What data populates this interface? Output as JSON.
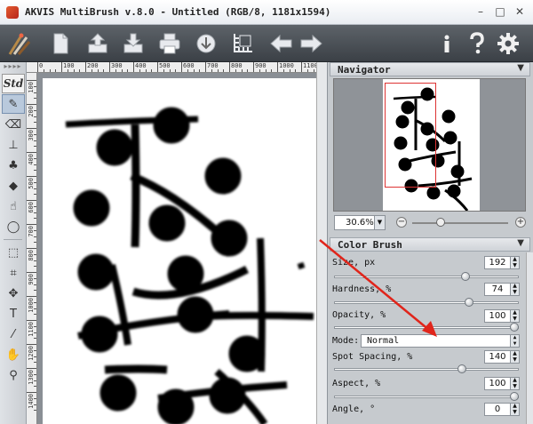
{
  "window": {
    "title": "AKVIS MultiBrush v.8.0 - Untitled (RGB/8, 1181x1594)",
    "minimize": "–",
    "maximize": "□",
    "close": "✕"
  },
  "toolbar": {
    "left_icons": [
      "brushes-logo-icon",
      "new-document-icon",
      "open-icon",
      "save-icon",
      "print-icon",
      "import-icon",
      "canvas-size-icon",
      "undo-icon",
      "redo-icon"
    ],
    "right_icons": [
      "info-icon",
      "help-icon",
      "settings-icon"
    ],
    "info_glyph": "i",
    "help_glyph": "?"
  },
  "tools": {
    "std_label": "Std",
    "grip": "▸▸▸▸"
  },
  "ruler": {
    "top_labels": [
      "0",
      "100",
      "200",
      "300",
      "400",
      "500",
      "600",
      "700",
      "800",
      "900",
      "1000",
      "1100"
    ],
    "left_labels": [
      "100",
      "200",
      "300",
      "400",
      "500",
      "600",
      "700",
      "800",
      "900",
      "1000",
      "1100",
      "1200",
      "1300",
      "1400"
    ]
  },
  "navigator": {
    "title": "Navigator",
    "collapse_glyph": "▼",
    "zoom": "30.6%",
    "zoom_minus": "−",
    "zoom_plus": "+",
    "zoom_level": 0.27
  },
  "color_brush": {
    "title": "Color Brush",
    "collapse_glyph": "▼",
    "params": [
      {
        "label": "Size, px",
        "value": "192",
        "fraction": 0.72
      },
      {
        "label": "Hardness, %",
        "value": "74",
        "fraction": 0.74
      },
      {
        "label": "Opacity, %",
        "value": "100",
        "fraction": 1.0
      },
      {
        "label": "Spot Spacing, %",
        "value": "140",
        "fraction": 0.7
      },
      {
        "label": "Aspect, %",
        "value": "100",
        "fraction": 1.0
      },
      {
        "label": "Angle, °",
        "value": "0",
        "fraction": 0.0
      }
    ],
    "mode_label": "Mode:",
    "mode_value": "Normal",
    "spinner_up": "▲",
    "spinner_down": "▼"
  },
  "colors": {
    "toolbar_bg": "#4a4f55",
    "annotation_arrow": "#e0251b",
    "canvas_bg": "#ffffff",
    "paint": "#000000"
  }
}
